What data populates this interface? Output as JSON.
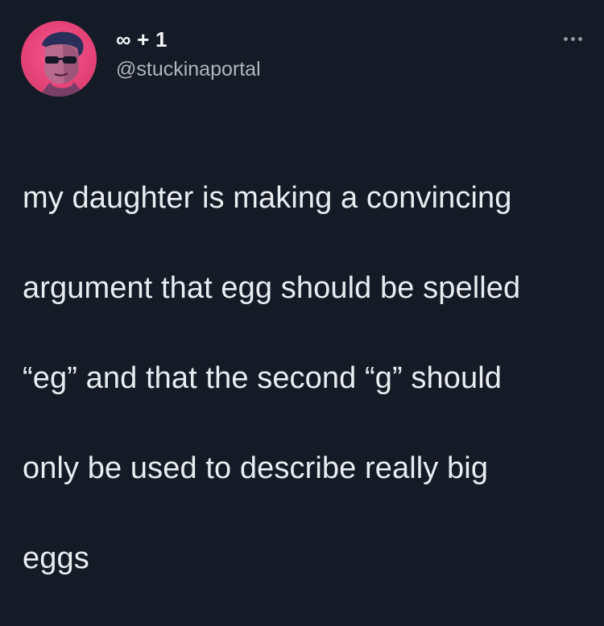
{
  "tweet": {
    "author": {
      "display_name": "∞ + 1",
      "handle": "@stuckinaportal",
      "avatar_icon": "user-avatar-sunglasses",
      "avatar_color": "#e64479"
    },
    "more_icon": "more-horizontal-icon",
    "text_lines": [
      "my daughter is making a convincing",
      "argument that egg should be spelled",
      "“eg” and that the second “g” should",
      "only be used to describe really big",
      "eggs"
    ]
  }
}
